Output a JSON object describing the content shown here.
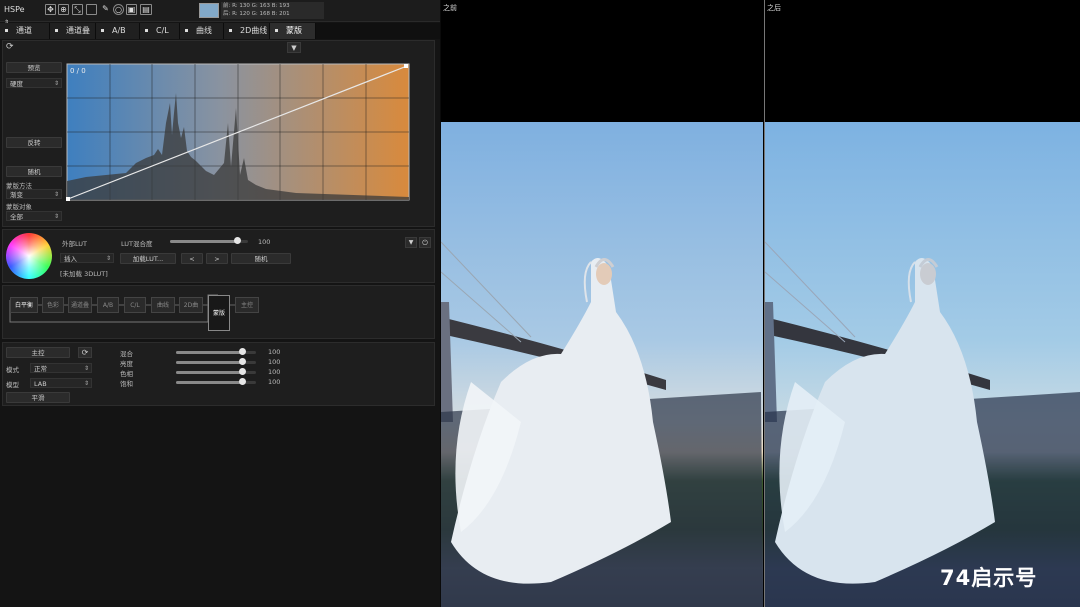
{
  "toolbar": {
    "mode": "HSPe",
    "icons": [
      "move-icon",
      "zoom-icon",
      "crop-icon",
      "select-icon",
      "eyedropper-icon",
      "magnifier-icon",
      "fit-icon",
      "view-icon"
    ],
    "swatch_color": "#82a9c9",
    "readout_line1": "前:  R: 130   G: 163   B: 193",
    "readout_line2": "后:  R: 120   G: 168   B: 201"
  },
  "tabs": [
    {
      "label": "通道"
    },
    {
      "label": "通道叠"
    },
    {
      "label": "A/B"
    },
    {
      "label": "C/L"
    },
    {
      "label": "曲线"
    },
    {
      "label": "2D曲线"
    },
    {
      "label": "蒙版",
      "active": true
    }
  ],
  "mask": {
    "preview_btn": "预览",
    "hardness_sel": "硬度",
    "invert_btn": "反转",
    "random_btn": "随机",
    "method_label": "蒙版方法",
    "method_sel": "渐变",
    "target_label": "蒙版对象",
    "target_sel": "全部",
    "curve_readout": "0 / 0"
  },
  "lut": {
    "external_label": "外部LUT",
    "blend_label": "LUT混合度",
    "blend_value": "100",
    "blend_fraction": 0.86,
    "mode_sel": "插入",
    "load_btn": "加载LUT...",
    "prev_btn": "<",
    "next_btn": ">",
    "random_btn": "随机",
    "status": "[未加载 3DLUT]"
  },
  "pipeline": {
    "nodes": [
      "白平衡",
      "色彩",
      "通道叠",
      "A/B",
      "C/L",
      "曲线",
      "2D曲",
      "蒙版",
      "主控"
    ]
  },
  "master": {
    "main_btn": "主控",
    "mode_label": "模式",
    "mode_sel": "正常",
    "model_label": "模型",
    "model_sel": "LAB",
    "smooth_btn": "平滑",
    "sliders": [
      {
        "label": "混合",
        "value": "100",
        "fraction": 0.82
      },
      {
        "label": "亮度",
        "value": "100",
        "fraction": 0.82
      },
      {
        "label": "色相",
        "value": "100",
        "fraction": 0.82
      },
      {
        "label": "饱和",
        "value": "100",
        "fraction": 0.82
      }
    ]
  },
  "compare": {
    "before_label": "之前",
    "after_label": "之后",
    "watermark": "74启示号"
  }
}
